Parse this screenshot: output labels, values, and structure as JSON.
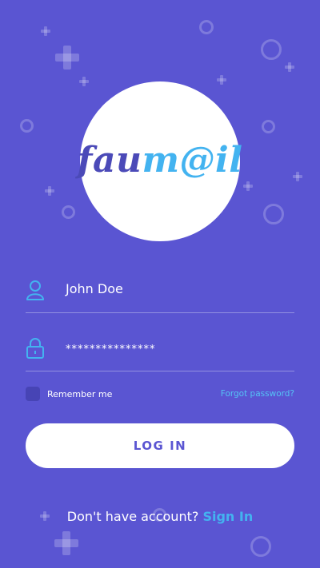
{
  "logo": {
    "part1": "fau",
    "part2": "m@il"
  },
  "username_field": {
    "value": "John Doe"
  },
  "password_field": {
    "value": "***************"
  },
  "remember": {
    "label": "Remember me"
  },
  "forgot_link": "Forgot password?",
  "login_button": "LOG IN",
  "signup": {
    "prompt": "Don't have account?",
    "link": "Sign In"
  },
  "colors": {
    "background": "#5a55d2",
    "accent": "#43b3f0",
    "logo_dark": "#4b4ab8"
  },
  "icons": [
    "user-icon",
    "lock-icon"
  ]
}
